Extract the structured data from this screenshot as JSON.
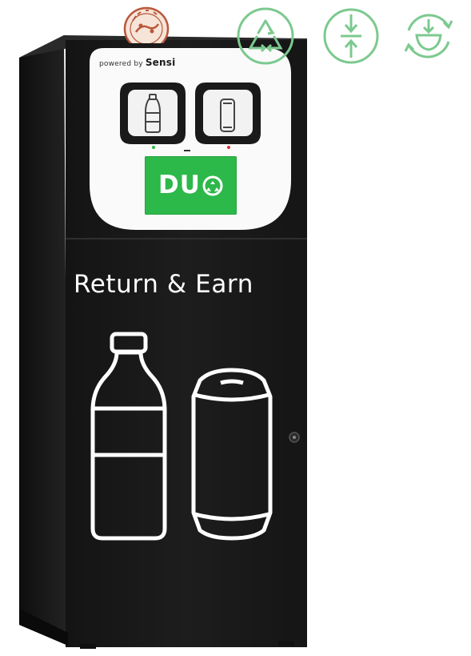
{
  "panel": {
    "powered_by": "powered by",
    "brand": "Sensi",
    "screen_logo": "DU"
  },
  "front": {
    "headline": "Return & Earn"
  },
  "icons": {
    "top_seal": "pakistan-seal-logo",
    "eco": [
      "recycle-arrows-icon",
      "compact-arrows-icon",
      "reuse-bowl-icon"
    ],
    "slot_left": "bottle-slot-icon",
    "slot_right": "can-slot-icon",
    "front_left": "bottle-icon",
    "front_right": "can-icon"
  },
  "colors": {
    "body": "#1a1a1a",
    "screen": "#2db84a",
    "eco_icon": "#7cc98f",
    "led_left": "#2db84a",
    "led_right": "#e03030"
  }
}
